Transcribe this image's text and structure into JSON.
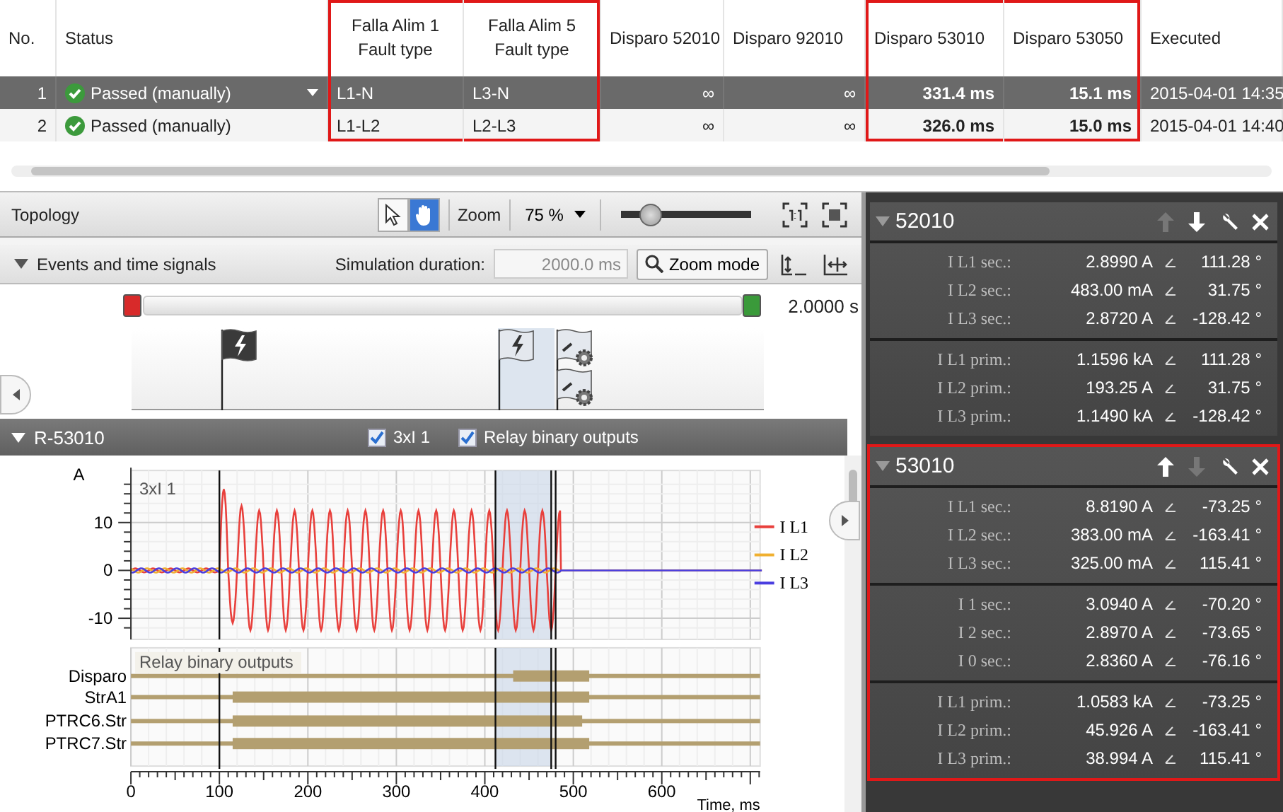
{
  "table": {
    "columns": [
      {
        "label": "No.",
        "kind": "index",
        "highlighted": false
      },
      {
        "label": "Status",
        "kind": "status",
        "highlighted": false
      },
      {
        "label": "Falla Alim 1",
        "sublabel": "Fault type",
        "kind": "text",
        "highlighted": true
      },
      {
        "label": "Falla Alim 5",
        "sublabel": "Fault type",
        "kind": "text",
        "highlighted": true
      },
      {
        "label": "Disparo 52010",
        "kind": "value",
        "highlighted": false
      },
      {
        "label": "Disparo 92010",
        "kind": "value",
        "highlighted": false
      },
      {
        "label": "Disparo 53010",
        "kind": "result",
        "highlighted": true
      },
      {
        "label": "Disparo 53050",
        "kind": "result",
        "highlighted": true
      },
      {
        "label": "Executed",
        "kind": "text",
        "highlighted": false
      }
    ],
    "rows": [
      {
        "selected": true,
        "cells": [
          "1",
          "Passed (manually)",
          "L1-N",
          "L3-N",
          "∞",
          "∞",
          "331.4 ms",
          "15.1 ms",
          "2015-04-01 14:35"
        ]
      },
      {
        "selected": false,
        "cells": [
          "2",
          "Passed (manually)",
          "L1-L2",
          "L2-L3",
          "∞",
          "∞",
          "326.0 ms",
          "15.0 ms",
          "2015-04-01 14:40"
        ]
      }
    ]
  },
  "topology": {
    "title": "Topology",
    "tools": [
      {
        "kind": "pointer",
        "selected": false
      },
      {
        "kind": "hand",
        "selected": true
      }
    ],
    "zoom_label": "Zoom",
    "zoom_value": "75 %",
    "zoom_slider": {
      "level": 0.22
    }
  },
  "events": {
    "title": "Events and time signals",
    "duration_label": "Simulation duration:",
    "duration_value": "2000.0 ms",
    "zoom_mode": "Zoom mode",
    "time_end": "2.0000 s"
  },
  "plot": {
    "title": "R-53010",
    "toggles": [
      {
        "label": "3xI 1",
        "checked": true
      },
      {
        "label": "Relay binary outputs",
        "checked": true
      }
    ],
    "y_unit": "A",
    "y_ticks": [
      "10",
      "0",
      "-10"
    ],
    "wave_title": "3xI 1",
    "legend": [
      {
        "label": "I L1",
        "color": "#e8403c"
      },
      {
        "label": "I L2",
        "color": "#f0b030"
      },
      {
        "label": "I L3",
        "color": "#4a3ee0"
      }
    ],
    "binary_title": "Relay binary outputs",
    "binary_rows": [
      "Disparo",
      "StrA1",
      "PTRC6.Str",
      "PTRC7.Str"
    ],
    "x_ticks": [
      "0",
      "100",
      "200",
      "300",
      "400",
      "500",
      "600"
    ],
    "x_label": "Time, ms"
  },
  "panels": [
    {
      "title": "52010",
      "up_disabled": true,
      "down_disabled": false,
      "highlighted": false,
      "groups": [
        [
          {
            "label": "I L1 sec.:",
            "value": "2.8990 A",
            "angle": "111.28 °"
          },
          {
            "label": "I L2 sec.:",
            "value": "483.00 mA",
            "angle": "31.75 °"
          },
          {
            "label": "I L3 sec.:",
            "value": "2.8720 A",
            "angle": "-128.42 °"
          }
        ],
        [
          {
            "label": "I L1 prim.:",
            "value": "1.1596 kA",
            "angle": "111.28 °"
          },
          {
            "label": "I L2 prim.:",
            "value": "193.25 A",
            "angle": "31.75 °"
          },
          {
            "label": "I L3 prim.:",
            "value": "1.1490 kA",
            "angle": "-128.42 °"
          }
        ]
      ]
    },
    {
      "title": "53010",
      "up_disabled": false,
      "down_disabled": true,
      "highlighted": true,
      "groups": [
        [
          {
            "label": "I L1 sec.:",
            "value": "8.8190 A",
            "angle": "-73.25 °"
          },
          {
            "label": "I L2 sec.:",
            "value": "383.00 mA",
            "angle": "-163.41 °"
          },
          {
            "label": "I L3 sec.:",
            "value": "325.00 mA",
            "angle": "115.41 °"
          }
        ],
        [
          {
            "label": "I 1 sec.:",
            "value": "3.0940 A",
            "angle": "-70.20 °"
          },
          {
            "label": "I 2 sec.:",
            "value": "2.8970 A",
            "angle": "-73.65 °"
          },
          {
            "label": "I 0 sec.:",
            "value": "2.8360 A",
            "angle": "-76.16 °"
          }
        ],
        [
          {
            "label": "I L1 prim.:",
            "value": "1.0583 kA",
            "angle": "-73.25 °"
          },
          {
            "label": "I L2 prim.:",
            "value": "45.926 A",
            "angle": "-163.41 °"
          },
          {
            "label": "I L3 prim.:",
            "value": "38.994 A",
            "angle": "115.41 °"
          }
        ]
      ]
    }
  ]
}
